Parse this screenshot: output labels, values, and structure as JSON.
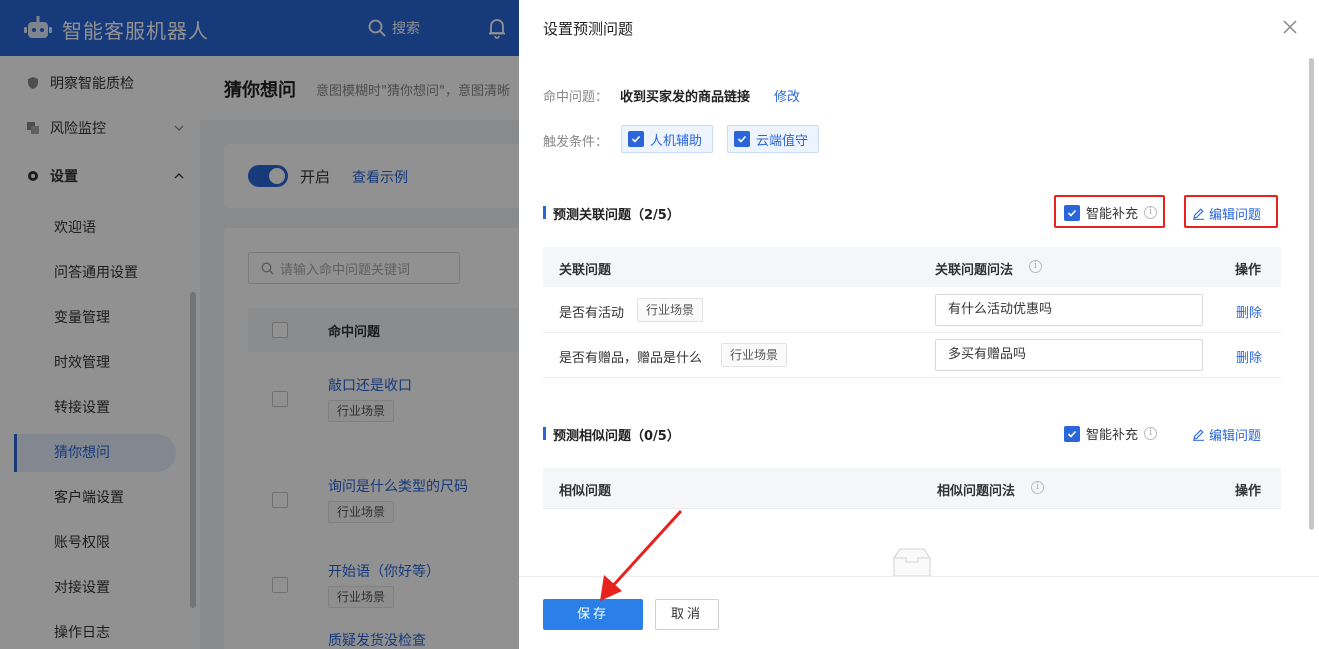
{
  "app": {
    "title": "智能客服机器人",
    "search_label": "搜索"
  },
  "sidebar": {
    "top_items": [
      {
        "label": "明察智能质检"
      },
      {
        "label": "风险监控",
        "chevron": "down"
      },
      {
        "label": "设置",
        "chevron": "up"
      }
    ],
    "sub_items": [
      {
        "label": "欢迎语"
      },
      {
        "label": "问答通用设置"
      },
      {
        "label": "变量管理"
      },
      {
        "label": "时效管理"
      },
      {
        "label": "转接设置"
      },
      {
        "label": "猜你想问",
        "active": true
      },
      {
        "label": "客户端设置"
      },
      {
        "label": "账号权限"
      },
      {
        "label": "对接设置"
      },
      {
        "label": "操作日志"
      }
    ]
  },
  "page": {
    "title": "猜你想问",
    "desc": "意图模糊时\"猜你想问\"，意图清晰",
    "toggle_label": "开启",
    "toggle_on": true,
    "example_link": "查看示例",
    "search_placeholder": "请输入命中问题关键词",
    "table_header": "命中问题",
    "rows": [
      {
        "question": "敲口还是收口",
        "tag": "行业场景"
      },
      {
        "question": "询问是什么类型的尺码",
        "tag": "行业场景"
      },
      {
        "question": "开始语（你好等）",
        "tag": "行业场景"
      },
      {
        "question": "质疑发货没检查"
      }
    ]
  },
  "drawer": {
    "title": "设置预测问题",
    "hit_label": "命中问题：",
    "hit_value": "收到买家发的商品链接",
    "modify_link": "修改",
    "trigger_label": "触发条件：",
    "triggers": [
      {
        "label": "人机辅助",
        "checked": true
      },
      {
        "label": "云端值守",
        "checked": true
      }
    ],
    "related": {
      "title": "预测关联问题（2/5）",
      "smart_label": "智能补充",
      "smart_checked": true,
      "edit_label": "编辑问题",
      "columns": [
        "关联问题",
        "关联问题问法",
        "操作"
      ],
      "rows": [
        {
          "question": "是否有活动",
          "tag": "行业场景",
          "phrase": "有什么活动优惠吗",
          "action": "删除"
        },
        {
          "question": "是否有赠品，赠品是什么",
          "tag": "行业场景",
          "phrase": "多买有赠品吗",
          "action": "删除"
        }
      ]
    },
    "similar": {
      "title": "预测相似问题（0/5）",
      "smart_label": "智能补充",
      "smart_checked": true,
      "edit_label": "编辑问题",
      "columns": [
        "相似问题",
        "相似问题问法",
        "操作"
      ]
    },
    "save_label": "保存",
    "cancel_label": "取消"
  },
  "colors": {
    "primary": "#2a66d9",
    "highlight": "#e8221c",
    "topbar": "#2a66d9"
  }
}
